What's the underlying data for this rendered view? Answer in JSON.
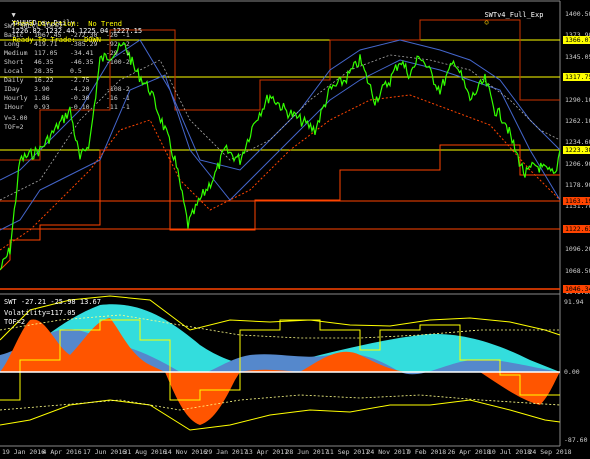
{
  "window": {
    "title": "XAUUSD.ev,Daily",
    "ohlc": "1226.82 1232.44 1225.04 1227.15",
    "expert_name": "SWTv4_Full_Exp",
    "smiley": "☺"
  },
  "status": {
    "trend_direction": "Trend Direction:  No Trend",
    "ready_to_trade": "Ready To Trade:  DOWN"
  },
  "indicator_title": "SWT_SRLvl_TOF=2",
  "table": [
    {
      "name": "Basic",
      "v1": "1067.45",
      "v2": "-272.30",
      "v3": "-26",
      "v4": "-1"
    },
    {
      "name": "Long",
      "v1": "419.71",
      "v2": "-385.29",
      "v3": "-92",
      "v4": "-2"
    },
    {
      "name": "Medium",
      "v1": "117.05",
      "v2": "-34.41",
      "v3": "-29",
      "v4": "-1"
    },
    {
      "name": "Short",
      "v1": "46.35",
      "v2": "-46.35",
      "v3": "-100",
      "v4": "-2"
    },
    {
      "name": "Local",
      "v1": "28.35",
      "v2": "0.5",
      "v3": "",
      "v4": ""
    },
    {
      "name": "Daily",
      "v1": "16.22",
      "v2": "-2.75",
      "v3": "",
      "v4": ""
    },
    {
      "name": "IDay",
      "v1": "3.90",
      "v2": "-4.20",
      "v3": "-108",
      "v4": "-2"
    },
    {
      "name": "Hourly",
      "v1": "1.86",
      "v2": "-0.30",
      "v3": "-16",
      "v4": "-1"
    },
    {
      "name": "IHour",
      "v1": "0.93",
      "v2": "-0.10",
      "v3": "-11",
      "v4": "-1"
    }
  ],
  "extra_lines": [
    "V=3.00",
    "TOF=2"
  ],
  "price_axis": [
    "1400.50",
    "1373.90",
    "1345.05",
    "1317.75",
    "1290.10",
    "1262.10",
    "1234.60",
    "1206.90",
    "1178.90",
    "1151.70",
    "1122.55",
    "1096.20",
    "1068.50",
    "1041.30"
  ],
  "price_labels": [
    {
      "text": "1366.07",
      "color": "#ffff00"
    },
    {
      "text": "1317.75",
      "color": "#ffff00"
    },
    {
      "text": "1223.38",
      "color": "#ffff00"
    },
    {
      "text": "1163.19",
      "color": "#ff4400"
    },
    {
      "text": "1122.63",
      "color": "#ff4400"
    },
    {
      "text": "1046.34",
      "color": "#ff4400"
    }
  ],
  "sub_window": {
    "title": "SWT -27.21 -25.98 13.67",
    "volatility": "Volatility=117.05",
    "tof": "TOF=2",
    "axis": [
      "91.94",
      "0.00",
      "-87.60"
    ]
  },
  "time_axis": [
    "19 Jan 2016",
    "4 Apr 2016",
    "17 Jun 2016",
    "31 Aug 2016",
    "14 Nov 2016",
    "29 Jan 2017",
    "13 Apr 2017",
    "28 Jun 2017",
    "11 Sep 2017",
    "24 Nov 2017",
    "9 Feb 2018",
    "26 Apr 2018",
    "10 Jul 2018",
    "24 Sep 2018"
  ],
  "colors": {
    "price": "#33ff00",
    "support": "#ff3300",
    "resistance_yellow": "#ffff00",
    "cyan_area": "#33dddd",
    "orange_area": "#ff5500",
    "blue_area": "#5588cc",
    "band_blue": "#4466cc"
  }
}
